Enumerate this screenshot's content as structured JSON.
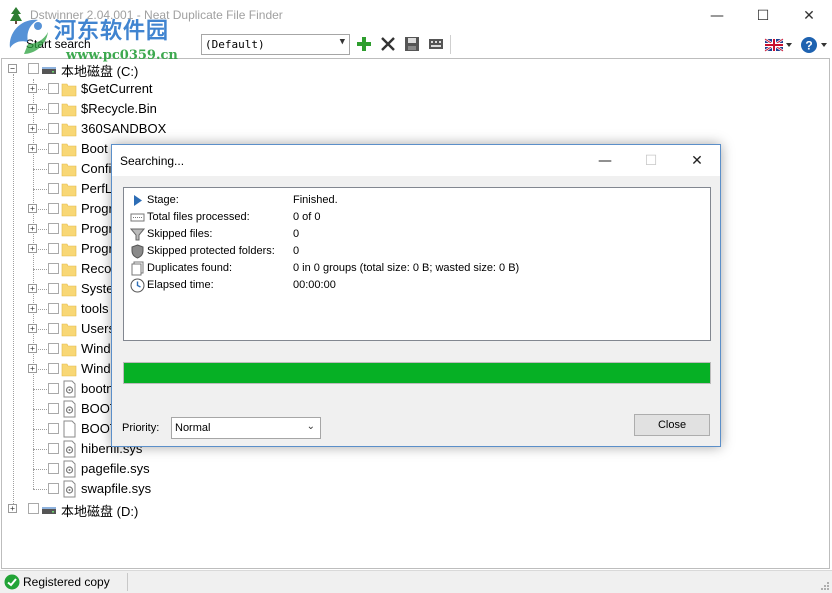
{
  "window": {
    "title": "Dstwinner 2.04.001 - Neat Duplicate File Finder",
    "min_glyph": "—",
    "max_glyph": "☐",
    "close_glyph": "✕"
  },
  "watermark": {
    "title": "河东软件园",
    "url": "www.pc0359.cn"
  },
  "toolbar": {
    "start_search": "Start search",
    "profile_value": "(Default)",
    "icons": [
      "add-icon",
      "remove-icon",
      "save-icon",
      "settings-icon",
      "uk-flag-icon",
      "help-icon"
    ]
  },
  "tree": {
    "drives": [
      {
        "label": "本地磁盘 (C:)"
      },
      {
        "label": "本地磁盘 (D:)"
      }
    ],
    "items": [
      {
        "label": "$GetCurrent",
        "type": "folder",
        "expandable": true
      },
      {
        "label": "$Recycle.Bin",
        "type": "folder",
        "expandable": true
      },
      {
        "label": "360SANDBOX",
        "type": "folder",
        "expandable": true
      },
      {
        "label": "Boot",
        "type": "folder",
        "expandable": true
      },
      {
        "label": "Confi",
        "type": "folder",
        "expandable": false
      },
      {
        "label": "PerfL",
        "type": "folder",
        "expandable": false
      },
      {
        "label": "Progr",
        "type": "folder",
        "expandable": true
      },
      {
        "label": "Progr",
        "type": "folder",
        "expandable": true
      },
      {
        "label": "Progr",
        "type": "folder",
        "expandable": true
      },
      {
        "label": "Recov",
        "type": "folder",
        "expandable": false
      },
      {
        "label": "Syste",
        "type": "folder",
        "expandable": true
      },
      {
        "label": "tools",
        "type": "folder",
        "expandable": true
      },
      {
        "label": "Users",
        "type": "folder",
        "expandable": true
      },
      {
        "label": "Wind",
        "type": "folder",
        "expandable": true
      },
      {
        "label": "Wind",
        "type": "folder",
        "expandable": true
      },
      {
        "label": "bootn",
        "type": "sysfile",
        "expandable": false
      },
      {
        "label": "BOOT",
        "type": "sysfile",
        "expandable": false
      },
      {
        "label": "BOOT",
        "type": "file",
        "expandable": false
      },
      {
        "label": "hiberfil.sys",
        "type": "sysfile",
        "expandable": false
      },
      {
        "label": "pagefile.sys",
        "type": "sysfile",
        "expandable": false
      },
      {
        "label": "swapfile.sys",
        "type": "sysfile",
        "expandable": false
      }
    ]
  },
  "status": {
    "text": "Registered copy"
  },
  "dialog": {
    "title": "Searching...",
    "rows": [
      {
        "icon": "play-icon",
        "label": "Stage:",
        "value": "Finished."
      },
      {
        "icon": "files-processed-icon",
        "label": "Total files processed:",
        "value": "0 of 0"
      },
      {
        "icon": "filter-icon",
        "label": "Skipped files:",
        "value": "0"
      },
      {
        "icon": "shield-icon",
        "label": "Skipped protected folders:",
        "value": "0"
      },
      {
        "icon": "duplicates-icon",
        "label": "Duplicates found:",
        "value": "0 in 0 groups (total size: 0 B; wasted size: 0 B)"
      },
      {
        "icon": "clock-icon",
        "label": "Elapsed time:",
        "value": "00:00:00"
      }
    ],
    "progress": 1.0,
    "priority_label": "Priority:",
    "priority_value": "Normal",
    "close_label": "Close"
  },
  "colors": {
    "progress": "#06b025",
    "folder": "#f8d775",
    "dialog_border": "#5b8fc9"
  }
}
